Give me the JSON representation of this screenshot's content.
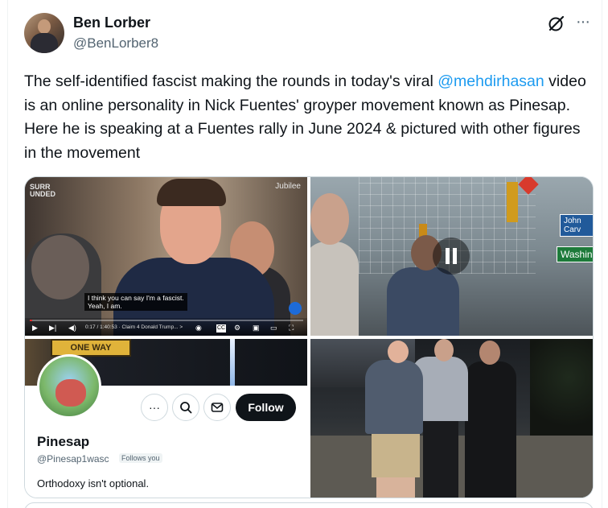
{
  "author": {
    "display_name": "Ben Lorber",
    "handle": "@BenLorber8",
    "avatar_icon": "user-avatar"
  },
  "header_icons": {
    "grok": "grok-icon",
    "more": "···"
  },
  "tweet": {
    "text_before": "The self-identified fascist making the rounds in today's viral ",
    "mention": "@mehdirhasan",
    "text_after": " video is an online personality in Nick Fuentes' groyper movement known as Pinesap. Here he is speaking at a Fuentes rally in June 2024 & pictured with other figures in the movement"
  },
  "media": {
    "video1": {
      "channel_logo_left": "SURR\nUNDED",
      "channel_logo_right": "Jubilee",
      "caption": "I think you can say I'm a fascist.\nYeah, I am.",
      "timecode": "0:17 / 1:40:53 · Claim 4 Donald Trump... >",
      "progress": 0.01
    },
    "video2": {
      "street_sign_1": "John Carv",
      "street_sign_2": "Washing",
      "state": "paused"
    },
    "profile_card": {
      "banner_sign": "ONE WAY",
      "name": "Pinesap",
      "handle": "@Pinesap1wasc",
      "follows_badge": "Follows you",
      "bio": "Orthodoxy isn't optional.",
      "follow_label": "Follow",
      "more_label": "···",
      "search_icon": "search-icon",
      "mail_icon": "mail-icon"
    }
  },
  "colors": {
    "accent": "#1d9bf0",
    "text": "#0f1419",
    "secondary": "#536471",
    "border": "#cfd9de"
  }
}
